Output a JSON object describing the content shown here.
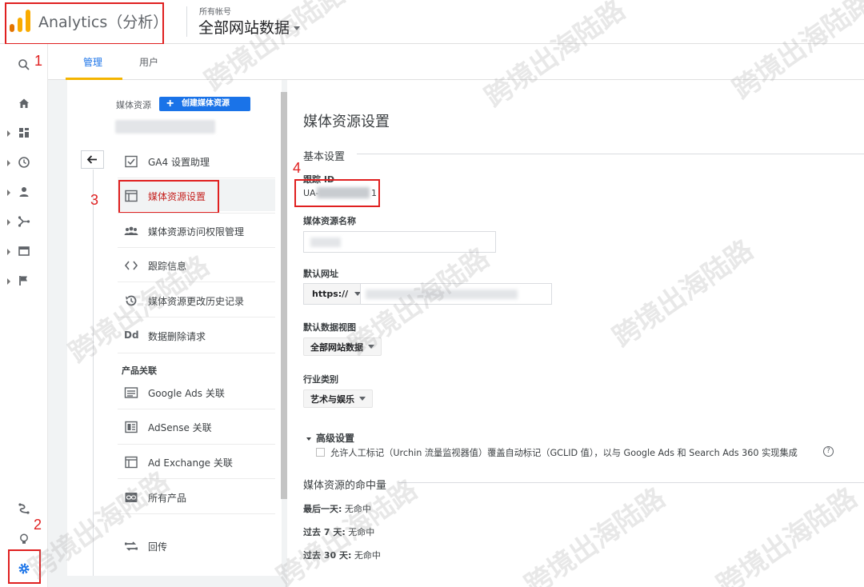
{
  "header": {
    "app_title": "Analytics（分析）",
    "account_label": "所有帐号",
    "account_value": "全部网站数据"
  },
  "tabs": [
    {
      "label": "管理",
      "active": true
    },
    {
      "label": "用户",
      "active": false
    }
  ],
  "rail": {
    "icons": [
      "search-icon",
      "home-icon",
      "dashboard-icon",
      "clock-icon",
      "person-icon",
      "acquisition-icon",
      "behavior-icon",
      "flag-icon",
      "attribution-icon",
      "lightbulb-icon",
      "gear-icon"
    ]
  },
  "annotations": {
    "n1": "1",
    "n2": "2",
    "n3": "3",
    "n4": "4"
  },
  "property": {
    "label": "媒体资源",
    "create_button": "创建媒体资源"
  },
  "nav": {
    "items": [
      {
        "label": "GA4 设置助理",
        "icon": "checklist-icon"
      },
      {
        "label": "媒体资源设置",
        "icon": "settings-window-icon",
        "active": true
      },
      {
        "label": "媒体资源访问权限管理",
        "icon": "people-icon"
      },
      {
        "label": "跟踪信息",
        "icon": "code-icon"
      },
      {
        "label": "媒体资源更改历史记录",
        "icon": "history-icon"
      },
      {
        "label": "数据删除请求",
        "icon": "dd-icon",
        "icon_text": "Dd"
      }
    ],
    "product_heading": "产品关联",
    "products": [
      {
        "label": "Google Ads 关联",
        "icon": "ads-icon"
      },
      {
        "label": "AdSense 关联",
        "icon": "adsense-icon"
      },
      {
        "label": "Ad Exchange 关联",
        "icon": "adexchange-icon"
      },
      {
        "label": "所有产品",
        "icon": "link-icon"
      },
      {
        "label": "回传",
        "icon": "postback-icon"
      }
    ]
  },
  "settings": {
    "title": "媒体资源设置",
    "basic_section": "基本设置",
    "tracking_id_label": "跟踪 ID",
    "tracking_id_value": "UA-",
    "tracking_id_suffix": "1",
    "property_name_label": "媒体资源名称",
    "default_url_label": "默认网址",
    "url_protocol": "https://",
    "default_view_label": "默认数据视图",
    "default_view_value": "全部网站数据",
    "industry_label": "行业类别",
    "industry_value": "艺术与娱乐",
    "advanced_title": "高级设置",
    "advanced_checkbox": "允许人工标记（Urchin 流量监视器值）覆盖自动标记（GCLID 值），以与 Google Ads 和 Search Ads 360 实现集成",
    "help_glyph": "?",
    "hits_section": "媒体资源的命中量",
    "hits": [
      {
        "label": "最后一天:",
        "value": "无命中"
      },
      {
        "label": "过去 7 天:",
        "value": "无命中"
      },
      {
        "label": "过去 30 天:",
        "value": "无命中"
      }
    ]
  },
  "watermark": "跨境出海陆路",
  "colors": {
    "accent_blue": "#1a73e8",
    "annotation_red": "#e02020",
    "tab_underline": "#f4b400",
    "logo_orange": "#f9ab00",
    "logo_dark": "#e37400"
  }
}
